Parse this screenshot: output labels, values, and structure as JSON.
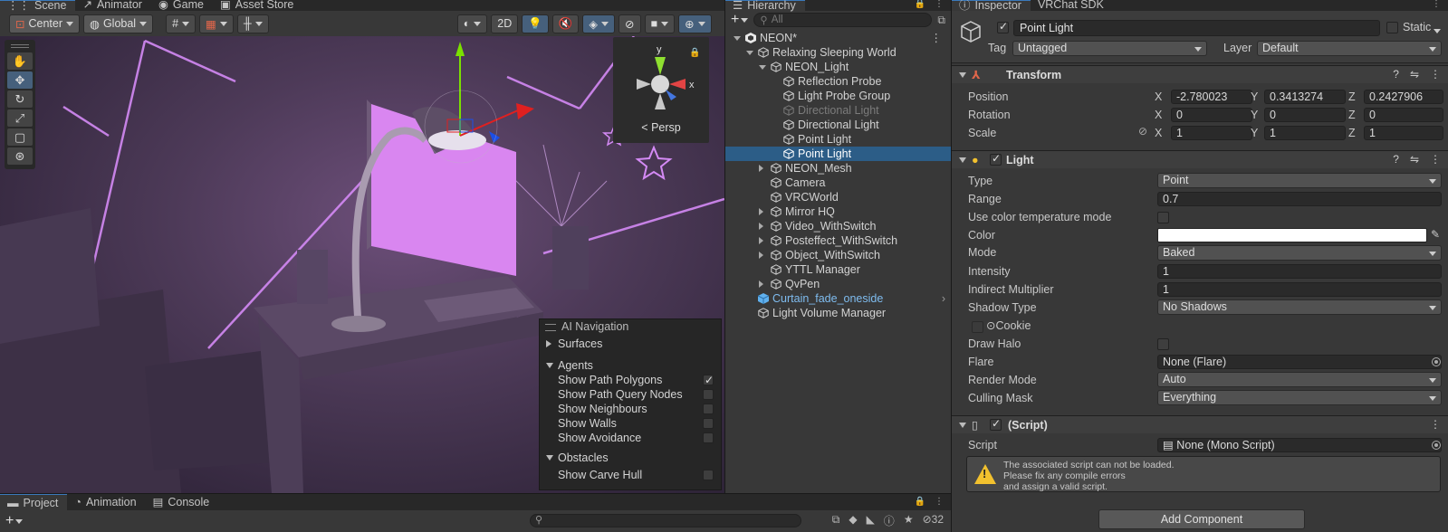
{
  "scene": {
    "tabs": [
      {
        "label": "Scene",
        "icon": "grid-icon"
      },
      {
        "label": "Animator",
        "icon": "animator-icon"
      },
      {
        "label": "Game",
        "icon": "gamepad-icon"
      },
      {
        "label": "Asset Store",
        "icon": "store-icon"
      }
    ],
    "toolbar": {
      "pivot_label": "Center",
      "space_label": "Global",
      "mode_2d_label": "2D"
    },
    "tools": [
      "hand-tool",
      "move-tool",
      "rotate-tool",
      "scale-tool",
      "rect-tool",
      "transform-tool"
    ],
    "gizmo": {
      "y_label": "y",
      "x_label": "x",
      "persp_label": "Persp"
    },
    "ai_navigation": {
      "title": "AI Navigation",
      "surfaces_label": "Surfaces",
      "agents_label": "Agents",
      "agent_options": [
        {
          "label": "Show Path Polygons",
          "checked": true
        },
        {
          "label": "Show Path Query Nodes",
          "checked": false
        },
        {
          "label": "Show Neighbours",
          "checked": false
        },
        {
          "label": "Show Walls",
          "checked": false
        },
        {
          "label": "Show Avoidance",
          "checked": false
        }
      ],
      "obstacles_label": "Obstacles",
      "obstacle_options": [
        {
          "label": "Show Carve Hull",
          "checked": false
        }
      ]
    }
  },
  "hierarchy": {
    "tab_label": "Hierarchy",
    "search_placeholder": "All",
    "items": [
      {
        "label": "NEON*",
        "depth": 0,
        "arrow": "open",
        "icon": "unity-scene-icon"
      },
      {
        "label": "Relaxing Sleeping World",
        "depth": 1,
        "arrow": "open",
        "icon": "gameobject-icon"
      },
      {
        "label": "NEON_Light",
        "depth": 2,
        "arrow": "open",
        "icon": "gameobject-icon"
      },
      {
        "label": "Reflection Probe",
        "depth": 3,
        "arrow": "none",
        "icon": "gameobject-icon"
      },
      {
        "label": "Light Probe Group",
        "depth": 3,
        "arrow": "none",
        "icon": "gameobject-icon"
      },
      {
        "label": "Directional Light",
        "depth": 3,
        "arrow": "none",
        "icon": "gameobject-icon",
        "dim": true
      },
      {
        "label": "Directional Light",
        "depth": 3,
        "arrow": "none",
        "icon": "gameobject-icon"
      },
      {
        "label": "Point Light",
        "depth": 3,
        "arrow": "none",
        "icon": "gameobject-icon"
      },
      {
        "label": "Point Light",
        "depth": 3,
        "arrow": "none",
        "icon": "gameobject-icon",
        "selected": true
      },
      {
        "label": "NEON_Mesh",
        "depth": 2,
        "arrow": "closed",
        "icon": "gameobject-icon"
      },
      {
        "label": "Camera",
        "depth": 2,
        "arrow": "none",
        "icon": "gameobject-icon"
      },
      {
        "label": "VRCWorld",
        "depth": 2,
        "arrow": "none",
        "icon": "gameobject-icon"
      },
      {
        "label": "Mirror HQ",
        "depth": 2,
        "arrow": "closed",
        "icon": "gameobject-icon"
      },
      {
        "label": "Video_WithSwitch",
        "depth": 2,
        "arrow": "closed",
        "icon": "gameobject-icon"
      },
      {
        "label": "Posteffect_WithSwitch",
        "depth": 2,
        "arrow": "closed",
        "icon": "gameobject-icon"
      },
      {
        "label": "Object_WithSwitch",
        "depth": 2,
        "arrow": "closed",
        "icon": "gameobject-icon"
      },
      {
        "label": "YTTL Manager",
        "depth": 2,
        "arrow": "none",
        "icon": "gameobject-icon"
      },
      {
        "label": "QvPen",
        "depth": 2,
        "arrow": "closed",
        "icon": "gameobject-icon"
      },
      {
        "label": "Curtain_fade_oneside",
        "depth": 1,
        "arrow": "none",
        "icon": "prefab-icon",
        "prefab": true
      },
      {
        "label": "Light Volume Manager",
        "depth": 1,
        "arrow": "none",
        "icon": "gameobject-icon"
      }
    ]
  },
  "inspector": {
    "tabs": [
      {
        "label": "Inspector",
        "icon": "info-icon"
      },
      {
        "label": "VRChat SDK",
        "icon": ""
      }
    ],
    "object_name": "Point Light",
    "static_label": "Static",
    "tag_label": "Tag",
    "tag_value": "Untagged",
    "layer_label": "Layer",
    "layer_value": "Default",
    "transform": {
      "title": "Transform",
      "position_label": "Position",
      "rotation_label": "Rotation",
      "scale_label": "Scale",
      "position": {
        "x": "-2.780023",
        "y": "0.3413274",
        "z": "0.2427906"
      },
      "rotation": {
        "x": "0",
        "y": "0",
        "z": "0"
      },
      "scale": {
        "x": "1",
        "y": "1",
        "z": "1"
      }
    },
    "light": {
      "title": "Light",
      "type_label": "Type",
      "type_value": "Point",
      "range_label": "Range",
      "range_value": "0.7",
      "color_temp_label": "Use color temperature mode",
      "color_label": "Color",
      "color_value": "#ffffff",
      "mode_label": "Mode",
      "mode_value": "Baked",
      "intensity_label": "Intensity",
      "intensity_value": "1",
      "indirect_label": "Indirect Multiplier",
      "indirect_value": "1",
      "shadow_label": "Shadow Type",
      "shadow_value": "No Shadows",
      "cookie_label": "Cookie",
      "halo_label": "Draw Halo",
      "flare_label": "Flare",
      "flare_value": "None (Flare)",
      "render_mode_label": "Render Mode",
      "render_mode_value": "Auto",
      "culling_label": "Culling Mask",
      "culling_value": "Everything"
    },
    "script": {
      "title": "(Script)",
      "script_label": "Script",
      "script_value": "None (Mono Script)",
      "warning_lines": [
        "The associated script can not be loaded.",
        "Please fix any compile errors",
        "and assign a valid script."
      ]
    },
    "add_component_label": "Add Component"
  },
  "project": {
    "tabs": [
      {
        "label": "Project",
        "icon": "folder-icon"
      },
      {
        "label": "Animation",
        "icon": "animation-icon"
      },
      {
        "label": "Console",
        "icon": "console-icon"
      }
    ],
    "hidden_count": "32"
  },
  "colors": {
    "accent": "#2c5d87",
    "panel": "#383838",
    "neon": "#c77cf0"
  }
}
